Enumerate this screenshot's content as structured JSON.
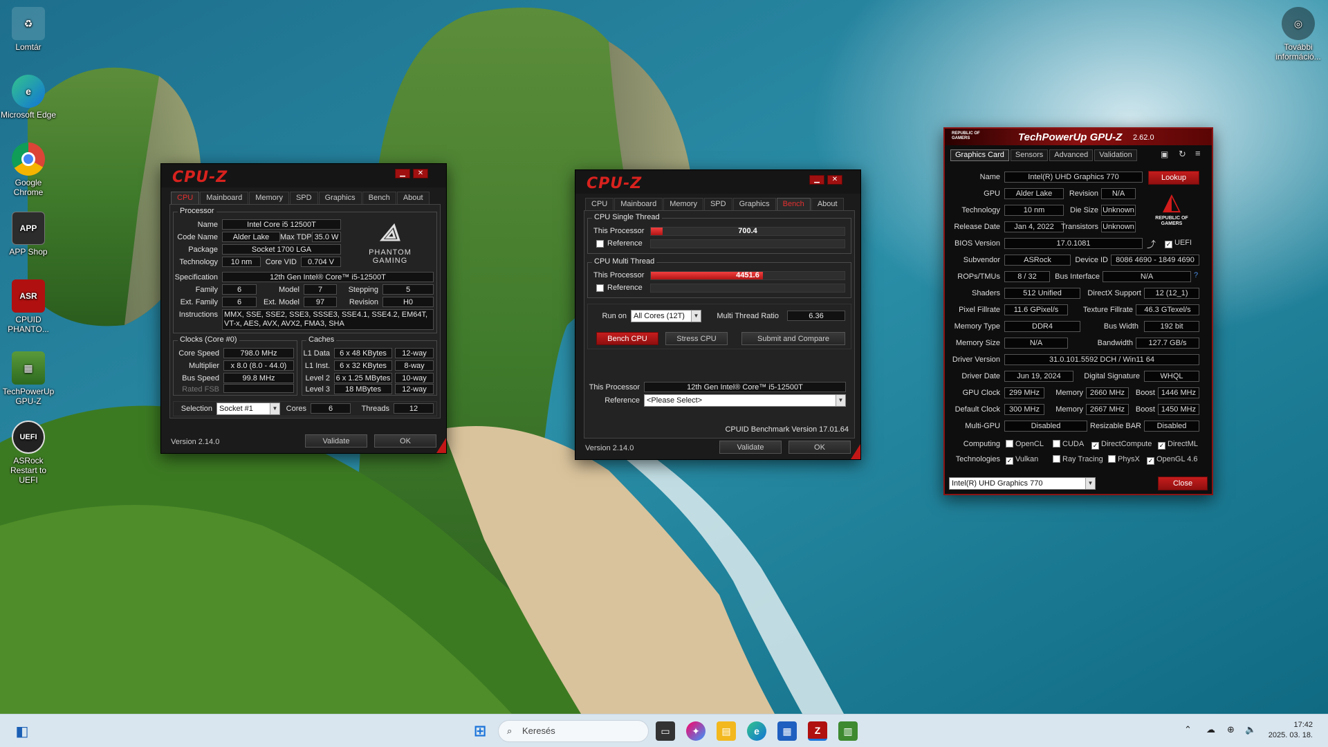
{
  "desktop": {
    "icons": [
      {
        "label": "Lomtár"
      },
      {
        "label": "Microsoft Edge"
      },
      {
        "label": "Google Chrome"
      },
      {
        "label": "APP Shop"
      },
      {
        "label": "CPUID PHANTO..."
      },
      {
        "label": "TechPowerUp GPU-Z"
      },
      {
        "label": "ASRock Restart to UEFI"
      }
    ],
    "top_right": {
      "label": "További információ..."
    }
  },
  "cpuz1": {
    "logo": "CPU-Z",
    "tabs": [
      "CPU",
      "Mainboard",
      "Memory",
      "SPD",
      "Graphics",
      "Bench",
      "About"
    ],
    "processor": {
      "title": "Processor",
      "name_label": "Name",
      "name": "Intel Core i5 12500T",
      "codename_label": "Code Name",
      "codename": "Alder Lake",
      "maxtdp_label": "Max TDP",
      "maxtdp": "35.0 W",
      "package_label": "Package",
      "package": "Socket 1700 LGA",
      "technology_label": "Technology",
      "technology": "10 nm",
      "corevid_label": "Core VID",
      "corevid": "0.704 V",
      "spec_label": "Specification",
      "spec": "12th Gen Intel® Core™ i5-12500T",
      "family_label": "Family",
      "family": "6",
      "model_label": "Model",
      "model": "7",
      "stepping_label": "Stepping",
      "stepping": "5",
      "extfamily_label": "Ext. Family",
      "extfamily": "6",
      "extmodel_label": "Ext. Model",
      "extmodel": "97",
      "revision_label": "Revision",
      "revision": "H0",
      "instructions_label": "Instructions",
      "instructions": "MMX, SSE, SSE2, SSE3, SSSE3, SSE4.1, SSE4.2, EM64T, VT-x, AES, AVX, AVX2, FMA3, SHA",
      "brand1": "PHANTOM",
      "brand2": "GAMING"
    },
    "clocks": {
      "title": "Clocks (Core #0)",
      "corespeed_label": "Core Speed",
      "corespeed": "798.0 MHz",
      "multiplier_label": "Multiplier",
      "multiplier": "x 8.0 (8.0 - 44.0)",
      "busspeed_label": "Bus Speed",
      "busspeed": "99.8 MHz",
      "ratedfsb_label": "Rated FSB",
      "ratedfsb": ""
    },
    "caches": {
      "title": "Caches",
      "l1d_label": "L1 Data",
      "l1d": "6 x 48 KBytes",
      "l1d_way": "12-way",
      "l1i_label": "L1 Inst.",
      "l1i": "6 x 32 KBytes",
      "l1i_way": "8-way",
      "l2_label": "Level 2",
      "l2": "6 x 1.25 MBytes",
      "l2_way": "10-way",
      "l3_label": "Level 3",
      "l3": "18 MBytes",
      "l3_way": "12-way"
    },
    "selection_label": "Selection",
    "selection": "Socket #1",
    "cores_label": "Cores",
    "cores": "6",
    "threads_label": "Threads",
    "threads": "12",
    "version": "Version 2.14.0",
    "validate": "Validate",
    "ok": "OK"
  },
  "cpuz2": {
    "logo": "CPU-Z",
    "tabs": [
      "CPU",
      "Mainboard",
      "Memory",
      "SPD",
      "Graphics",
      "Bench",
      "About"
    ],
    "single": {
      "title": "CPU Single Thread",
      "this_label": "This Processor",
      "this_value": "700.4",
      "this_fill": 0.06,
      "ref_label": "Reference"
    },
    "multi": {
      "title": "CPU Multi Thread",
      "this_label": "This Processor",
      "this_value": "4451.6",
      "this_fill": 0.58,
      "ref_label": "Reference"
    },
    "runon_label": "Run on",
    "runon": "All Cores (12T)",
    "ratio_label": "Multi Thread Ratio",
    "ratio": "6.36",
    "bench_btn": "Bench CPU",
    "stress_btn": "Stress CPU",
    "submit_btn": "Submit and Compare",
    "proc_label": "This Processor",
    "proc": "12th Gen Intel® Core™ i5-12500T",
    "ref_label": "Reference",
    "ref": "<Please Select>",
    "bench_version": "CPUID Benchmark Version 17.01.64",
    "version": "Version 2.14.0",
    "validate": "Validate",
    "ok": "OK"
  },
  "gpuz": {
    "brand": "REPUBLIC OF GAMERS",
    "title": "TechPowerUp GPU-Z",
    "version": "2.62.0",
    "tabs": [
      "Graphics Card",
      "Sensors",
      "Advanced",
      "Validation"
    ],
    "rog_label": "REPUBLIC OF GAMERS",
    "name_label": "Name",
    "name": "Intel(R) UHD Graphics 770",
    "lookup": "Lookup",
    "gpu_label": "GPU",
    "gpu": "Alder Lake",
    "revision_label": "Revision",
    "revision": "N/A",
    "tech_label": "Technology",
    "tech": "10 nm",
    "diesize_label": "Die Size",
    "diesize": "Unknown",
    "release_label": "Release Date",
    "release": "Jan 4, 2022",
    "transistors_label": "Transistors",
    "transistors": "Unknown",
    "bios_label": "BIOS Version",
    "bios": "17.0.1081",
    "uefi_label": "UEFI",
    "subvendor_label": "Subvendor",
    "subvendor": "ASRock",
    "deviceid_label": "Device ID",
    "deviceid": "8086 4690 - 1849 4690",
    "rops_label": "ROPs/TMUs",
    "rops": "8 / 32",
    "busif_label": "Bus Interface",
    "busif": "N/A",
    "shaders_label": "Shaders",
    "shaders": "512 Unified",
    "dx_label": "DirectX Support",
    "dx": "12 (12_1)",
    "pixel_label": "Pixel Fillrate",
    "pixel": "11.6 GPixel/s",
    "texture_label": "Texture Fillrate",
    "texture": "46.3 GTexel/s",
    "memtype_label": "Memory Type",
    "memtype": "DDR4",
    "buswidth_label": "Bus Width",
    "buswidth": "192 bit",
    "memsize_label": "Memory Size",
    "memsize": "N/A",
    "bandwidth_label": "Bandwidth",
    "bandwidth": "127.7 GB/s",
    "driver_label": "Driver Version",
    "driver": "31.0.101.5592 DCH / Win11 64",
    "driverdate_label": "Driver Date",
    "driverdate": "Jun 19, 2024",
    "digsig_label": "Digital Signature",
    "digsig": "WHQL",
    "gpuclock_label": "GPU Clock",
    "gpuclock": "299 MHz",
    "mem1_label": "Memory",
    "mem1": "2660 MHz",
    "boost1_label": "Boost",
    "boost1": "1446 MHz",
    "defclock_label": "Default Clock",
    "defclock": "300 MHz",
    "mem2_label": "Memory",
    "mem2": "2667 MHz",
    "boost2_label": "Boost",
    "boost2": "1450 MHz",
    "multigpu_label": "Multi-GPU",
    "multigpu": "Disabled",
    "rebar_label": "Resizable BAR",
    "rebar": "Disabled",
    "computing_label": "Computing",
    "computing": [
      {
        "label": "OpenCL",
        "checked": false
      },
      {
        "label": "CUDA",
        "checked": false
      },
      {
        "label": "DirectCompute",
        "checked": true
      },
      {
        "label": "DirectML",
        "checked": true
      }
    ],
    "technologies_label": "Technologies",
    "technologies": [
      {
        "label": "Vulkan",
        "checked": true
      },
      {
        "label": "Ray Tracing",
        "checked": false
      },
      {
        "label": "PhysX",
        "checked": false
      },
      {
        "label": "OpenGL 4.6",
        "checked": true
      }
    ],
    "device_select": "Intel(R) UHD Graphics 770",
    "close": "Close"
  },
  "taskbar": {
    "search_placeholder": "Keresés",
    "time": "17:42",
    "date": "2025. 03. 18."
  }
}
